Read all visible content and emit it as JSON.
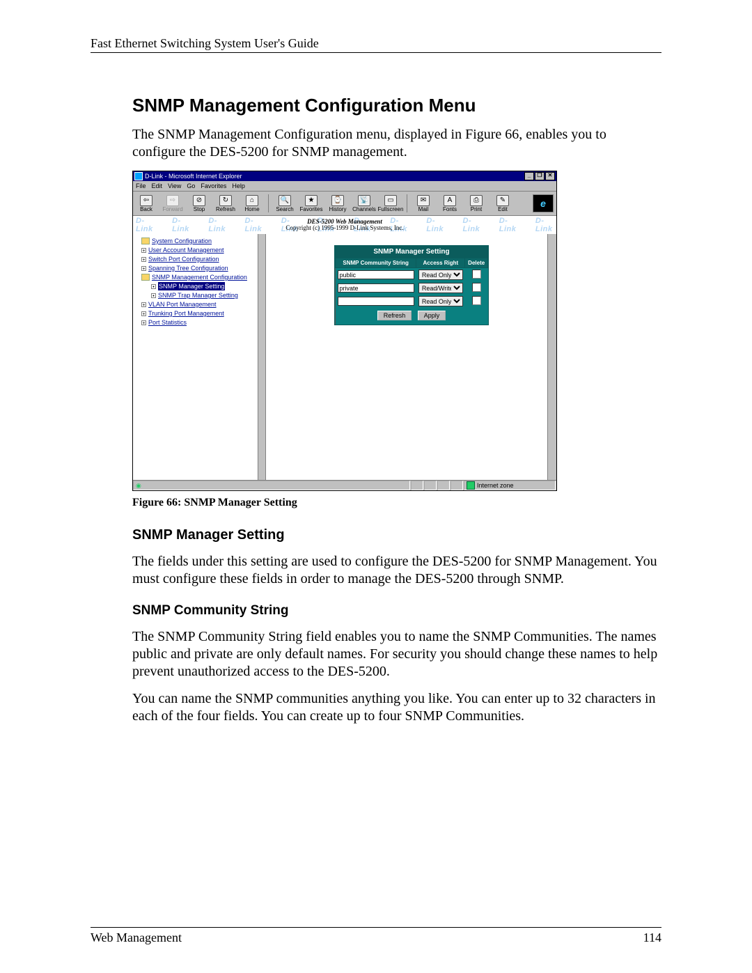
{
  "header": "Fast Ethernet Switching System User's Guide",
  "h1": "SNMP Management Configuration Menu",
  "p_intro": "The SNMP Management Configuration menu, displayed in Figure 66, enables you to configure the DES-5200 for SNMP management.",
  "caption": "Figure 66: SNMP Manager Setting",
  "h2": "SNMP Manager Setting",
  "p_h2": "The fields under this setting are used to configure the DES-5200 for SNMP Management. You must configure these fields in order to manage the DES-5200 through SNMP.",
  "h3": "SNMP Community String",
  "p_h3a": "The SNMP Community String field enables you to name the SNMP Communities. The names public and private are only default names. For security you should change these names to help prevent unauthorized access to the DES-5200.",
  "p_h3b": "You can name the SNMP communities anything you like. You can enter up to 32 characters in each of the four fields. You can create up to four SNMP Communities.",
  "footer_left": "Web Management",
  "footer_right": "114",
  "shot": {
    "title": "D-Link - Microsoft Internet Explorer",
    "win_min": "_",
    "win_max": "❐",
    "win_close": "✕",
    "menu": [
      "File",
      "Edit",
      "View",
      "Go",
      "Favorites",
      "Help"
    ],
    "toolbar": [
      {
        "label": "Back",
        "glyph": "⇦"
      },
      {
        "label": "Forward",
        "glyph": "⇨",
        "disabled": true
      },
      {
        "label": "Stop",
        "glyph": "⊘"
      },
      {
        "label": "Refresh",
        "glyph": "↻"
      },
      {
        "label": "Home",
        "glyph": "⌂"
      },
      {
        "label": "Search",
        "glyph": "🔍"
      },
      {
        "label": "Favorites",
        "glyph": "★"
      },
      {
        "label": "History",
        "glyph": "⌚"
      },
      {
        "label": "Channels",
        "glyph": "📡"
      },
      {
        "label": "Fullscreen",
        "glyph": "▭"
      },
      {
        "label": "Mail",
        "glyph": "✉"
      },
      {
        "label": "Fonts",
        "glyph": "A"
      },
      {
        "label": "Print",
        "glyph": "⎙"
      },
      {
        "label": "Edit",
        "glyph": "✎"
      }
    ],
    "banner_title": "DES-5200 Web Management",
    "banner_sub": "Copyright (c) 1995-1999 D-Link Systems, Inc.",
    "watermark": "D-Link",
    "tree": {
      "n0": "System Configuration",
      "n1": "User Account Management",
      "n2": "Switch Port Configuration",
      "n3": "Spanning Tree Configuration",
      "n4": "SNMP Management Configuration",
      "n4a": "SNMP Manager Setting",
      "n4b": "SNMP Trap Manager Setting",
      "n5": "VLAN Port Management",
      "n6": "Trunking Port Management",
      "n7": "Port Statistics"
    },
    "panel": {
      "title": "SNMP Manager Setting",
      "col_comm": "SNMP Community String",
      "col_access": "Access Right",
      "col_delete": "Delete",
      "rows": [
        {
          "comm": "public",
          "access": "Read Only"
        },
        {
          "comm": "private",
          "access": "Read/Write"
        },
        {
          "comm": "",
          "access": "Read Only"
        }
      ],
      "btn_refresh": "Refresh",
      "btn_apply": "Apply"
    },
    "status_zone": "Internet zone"
  }
}
